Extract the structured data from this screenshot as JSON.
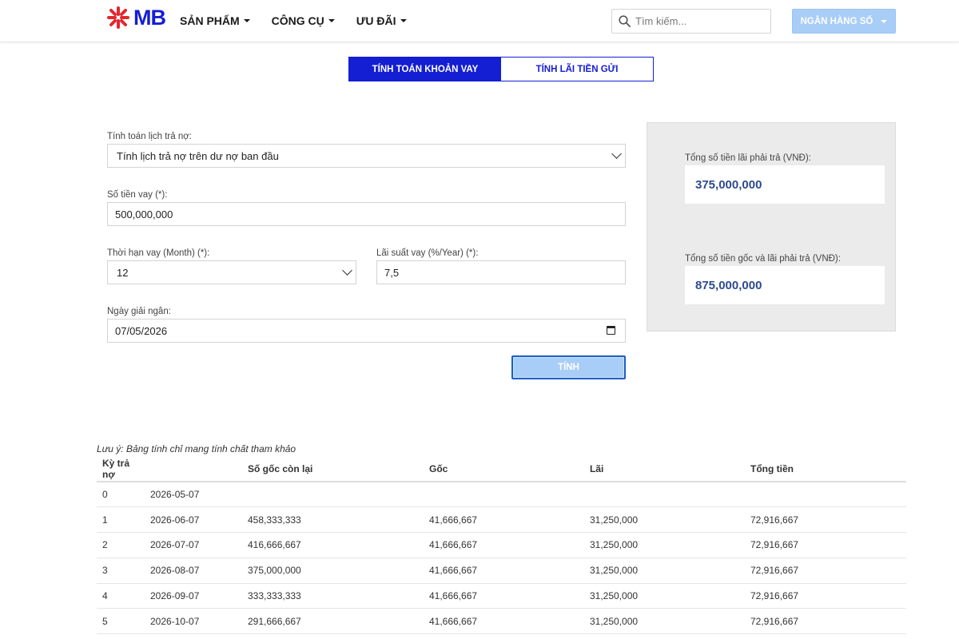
{
  "brand": {
    "name": "MB",
    "accent": "#141ed2"
  },
  "nav": [
    {
      "label": "SẢN PHẨM"
    },
    {
      "label": "CÔNG CỤ"
    },
    {
      "label": "ƯU ĐÃI"
    }
  ],
  "search": {
    "placeholder": "Tìm kiếm..."
  },
  "bank_button": "NGÂN HÀNG SỐ",
  "tabs": [
    {
      "label": "TÍNH TOÁN KHOẢN VAY",
      "active": true
    },
    {
      "label": "TÍNH LÃI TIỀN GỬI",
      "active": false
    }
  ],
  "form": {
    "schedule_label": "Tính toán lịch trả nợ:",
    "schedule_value": "Tính lịch trả nợ trên dư nợ ban đầu",
    "amount_label": "Số tiền vay (*):",
    "amount_value": "500,000,000",
    "term_label": "Thời hạn vay (Month) (*):",
    "term_value": "12",
    "rate_label": "Lãi suất vay (%/Year) (*):",
    "rate_value": "7,5",
    "date_label": "Ngày giải ngân:",
    "date_value": "07/05/2026",
    "submit": "TÍNH"
  },
  "result": {
    "interest_label": "Tổng số tiền lãi phải trả (VNĐ):",
    "interest_value": "375,000,000",
    "total_label": "Tổng số tiền gốc và lãi phải trả (VNĐ):",
    "total_value": "875,000,000"
  },
  "table": {
    "note": "Lưu ý: Bảng tính chỉ mang tính chất tham khảo",
    "headers": [
      "Kỳ trả nợ",
      "",
      "Số gốc còn lại",
      "Gốc",
      "Lãi",
      "Tổng tiền"
    ],
    "rows": [
      [
        "0",
        "2026-05-07",
        "",
        "",
        "",
        ""
      ],
      [
        "1",
        "2026-06-07",
        "458,333,333",
        "41,666,667",
        "31,250,000",
        "72,916,667"
      ],
      [
        "2",
        "2026-07-07",
        "416,666,667",
        "41,666,667",
        "31,250,000",
        "72,916,667"
      ],
      [
        "3",
        "2026-08-07",
        "375,000,000",
        "41,666,667",
        "31,250,000",
        "72,916,667"
      ],
      [
        "4",
        "2026-09-07",
        "333,333,333",
        "41,666,667",
        "31,250,000",
        "72,916,667"
      ],
      [
        "5",
        "2026-10-07",
        "291,666,667",
        "41,666,667",
        "31,250,000",
        "72,916,667"
      ]
    ]
  }
}
